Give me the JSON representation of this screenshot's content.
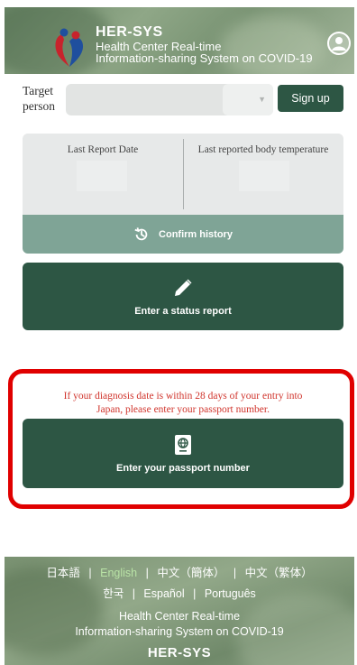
{
  "header": {
    "brand_name": "HER-SYS",
    "subtitle_line1": "Health Center Real-time",
    "subtitle_line2": "Information-sharing System on COVID-19",
    "account_icon": "account-circle-icon"
  },
  "target": {
    "label_line1": "Target",
    "label_line2": "person",
    "selected_value": "",
    "signup_label": "Sign up"
  },
  "report": {
    "last_report_date_label": "Last Report Date",
    "last_report_date_value": "",
    "last_temp_label": "Last reported body temperature",
    "last_temp_value": "",
    "confirm_history_label": "Confirm history",
    "confirm_history_icon": "history-icon"
  },
  "status": {
    "label": "Enter a status report",
    "icon": "pencil-icon"
  },
  "passport": {
    "notice_line1": "If your diagnosis date is within 28 days of your entry into",
    "notice_line2": "Japan, please enter your passport number.",
    "label": "Enter your passport number",
    "icon": "passport-icon"
  },
  "footer": {
    "languages_row1": [
      "日本語",
      "English",
      "中文（簡体）",
      "中文（繁体）"
    ],
    "languages_row2": [
      "한국",
      "Español",
      "Português"
    ],
    "active_language": "English",
    "subtitle_line1": "Health Center Real-time",
    "subtitle_line2": "Information-sharing System on COVID-19",
    "brand_name": "HER-SYS"
  },
  "colors": {
    "primary": "#2d5644",
    "secondary": "#7fa496",
    "highlight": "#e00000",
    "notice_text": "#d0342c",
    "active_language": "#b9e3a6"
  }
}
